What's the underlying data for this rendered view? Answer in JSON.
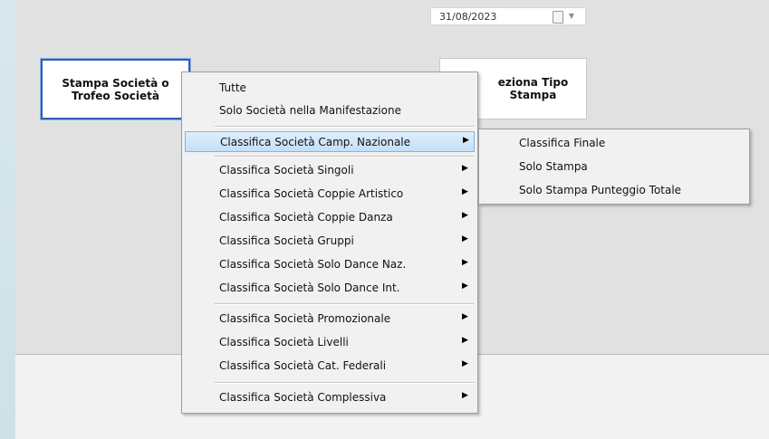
{
  "date_field": {
    "value": "31/08/2023"
  },
  "buttons": {
    "stampa_societa": "Stampa Società o\nTrofeo Società",
    "tipo_stampa": "eziona Tipo\nStampa"
  },
  "context_menu": {
    "items": [
      {
        "label": "Tutte",
        "submenu": false
      },
      {
        "label": "Solo Società nella Manifestazione",
        "submenu": false
      },
      {
        "label": "Classifica Società Camp. Nazionale",
        "submenu": true,
        "highlighted": true
      },
      {
        "label": "Classifica Società Singoli",
        "submenu": true
      },
      {
        "label": "Classifica Società Coppie Artistico",
        "submenu": true
      },
      {
        "label": "Classifica Società Coppie Danza",
        "submenu": true
      },
      {
        "label": "Classifica Società Gruppi",
        "submenu": true
      },
      {
        "label": "Classifica Società Solo Dance Naz.",
        "submenu": true
      },
      {
        "label": "Classifica Società Solo Dance Int.",
        "submenu": true
      },
      {
        "label": "Classifica Società Promozionale",
        "submenu": true
      },
      {
        "label": "Classifica Società Livelli",
        "submenu": true
      },
      {
        "label": "Classifica Società Cat. Federali",
        "submenu": true
      },
      {
        "label": "Classifica Società Complessiva",
        "submenu": true
      }
    ],
    "submenu_arrow": "▶"
  },
  "submenu": {
    "items": [
      {
        "label": "Classifica Finale"
      },
      {
        "label": "Solo Stampa"
      },
      {
        "label": "Solo Stampa Punteggio Totale"
      }
    ]
  },
  "colors": {
    "highlight": "#c4dff7",
    "highlight_border": "#7eb4ea",
    "focused_button_border": "#2f5fb3"
  }
}
